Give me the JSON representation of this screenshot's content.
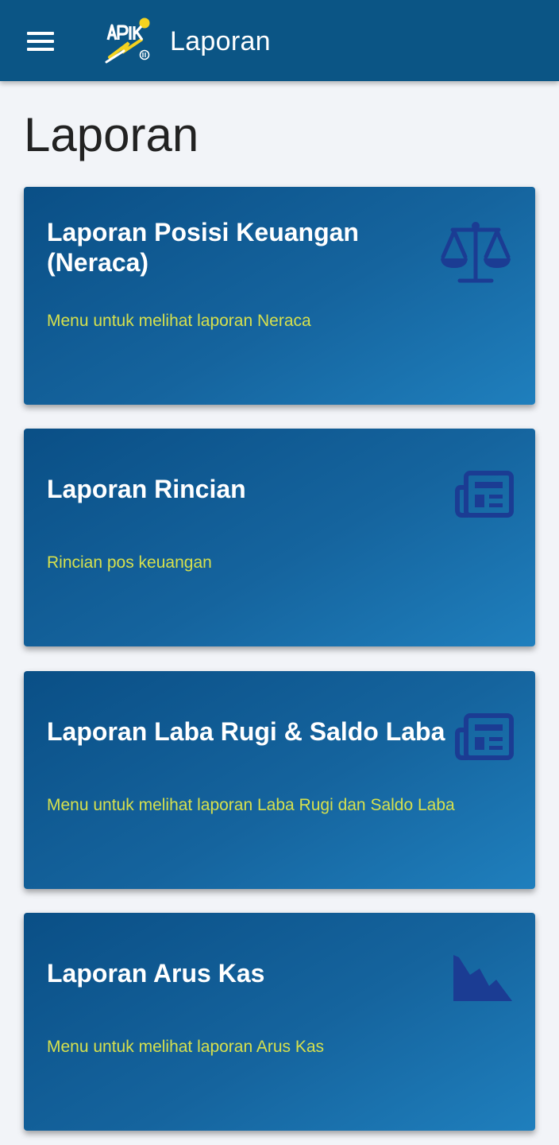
{
  "appbar": {
    "title": "Laporan",
    "logo_text": "APIK",
    "menu_icon": "hamburger-menu-icon"
  },
  "page": {
    "title": "Laporan"
  },
  "cards": [
    {
      "title": "Laporan Posisi Keuangan (Neraca)",
      "description": "Menu untuk melihat laporan Neraca",
      "icon": "balance-scale-icon"
    },
    {
      "title": "Laporan Rincian",
      "description": "Rincian pos keuangan",
      "icon": "newspaper-icon"
    },
    {
      "title": "Laporan Laba Rugi & Saldo Laba",
      "description": "Menu untuk melihat laporan Laba Rugi dan Saldo Laba",
      "icon": "newspaper-icon"
    },
    {
      "title": "Laporan Arus Kas",
      "description": "Menu untuk melihat laporan Arus Kas",
      "icon": "area-chart-icon"
    }
  ],
  "colors": {
    "appbar": "#0b5585",
    "card_gradient_start": "#0a4f86",
    "card_gradient_end": "#1f7fbd",
    "card_title": "#ffffff",
    "card_description": "#d6e04d",
    "card_icon": "#1b3c93",
    "page_background": "#f2f4f8"
  }
}
